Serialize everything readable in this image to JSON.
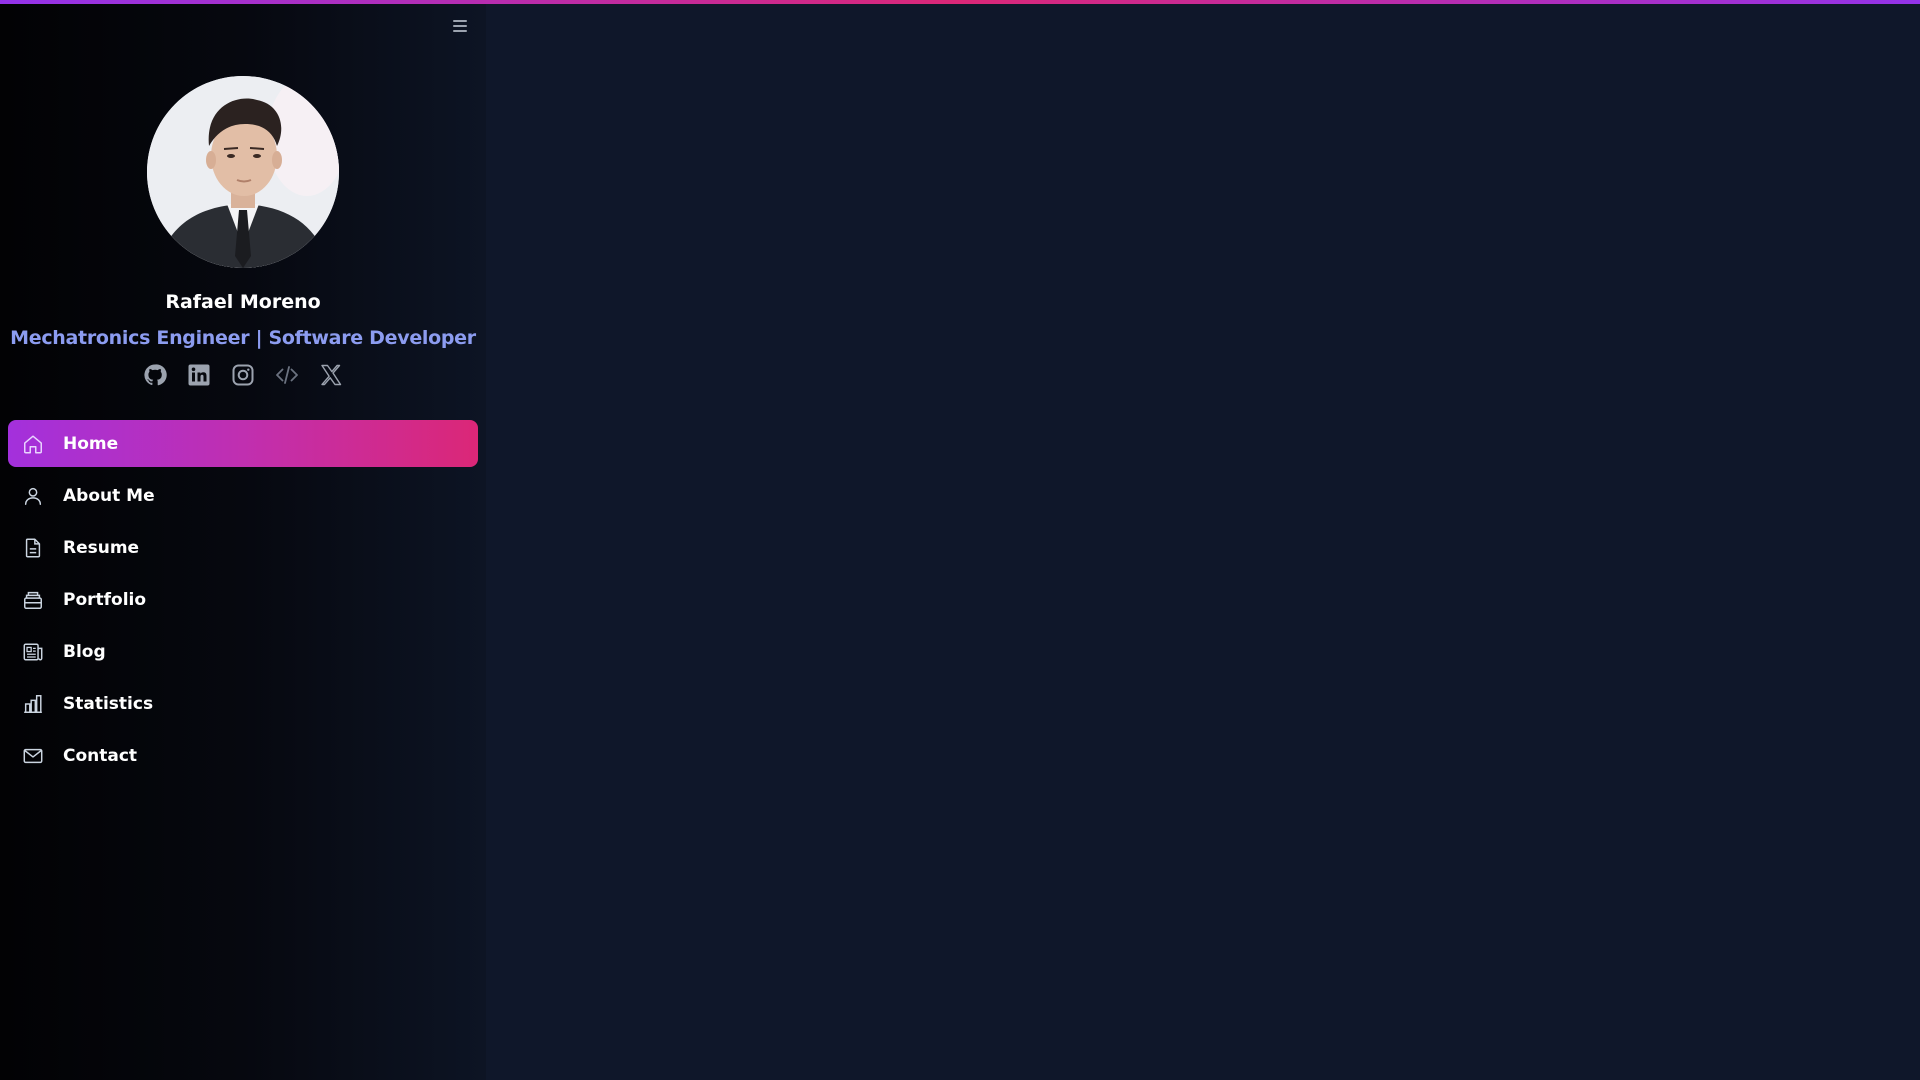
{
  "profile": {
    "name": "Rafael Moreno",
    "title": "Mechatronics Engineer | Software Developer"
  },
  "socials": [
    {
      "icon": "github-icon"
    },
    {
      "icon": "linkedin-icon"
    },
    {
      "icon": "instagram-icon"
    },
    {
      "icon": "code-icon"
    },
    {
      "icon": "x-twitter-icon"
    }
  ],
  "nav": {
    "items": [
      {
        "label": "Home",
        "icon": "home-icon",
        "active": true
      },
      {
        "label": "About Me",
        "icon": "user-icon"
      },
      {
        "label": "Resume",
        "icon": "document-icon"
      },
      {
        "label": "Portfolio",
        "icon": "portfolio-icon"
      },
      {
        "label": "Blog",
        "icon": "newspaper-icon"
      },
      {
        "label": "Statistics",
        "icon": "chart-bar-icon"
      },
      {
        "label": "Contact",
        "icon": "mail-icon"
      }
    ]
  },
  "colors": {
    "accent_start": "#9333ea",
    "accent_end": "#db2777",
    "subtitle": "#8c9cf0",
    "background": "#0f172a"
  }
}
